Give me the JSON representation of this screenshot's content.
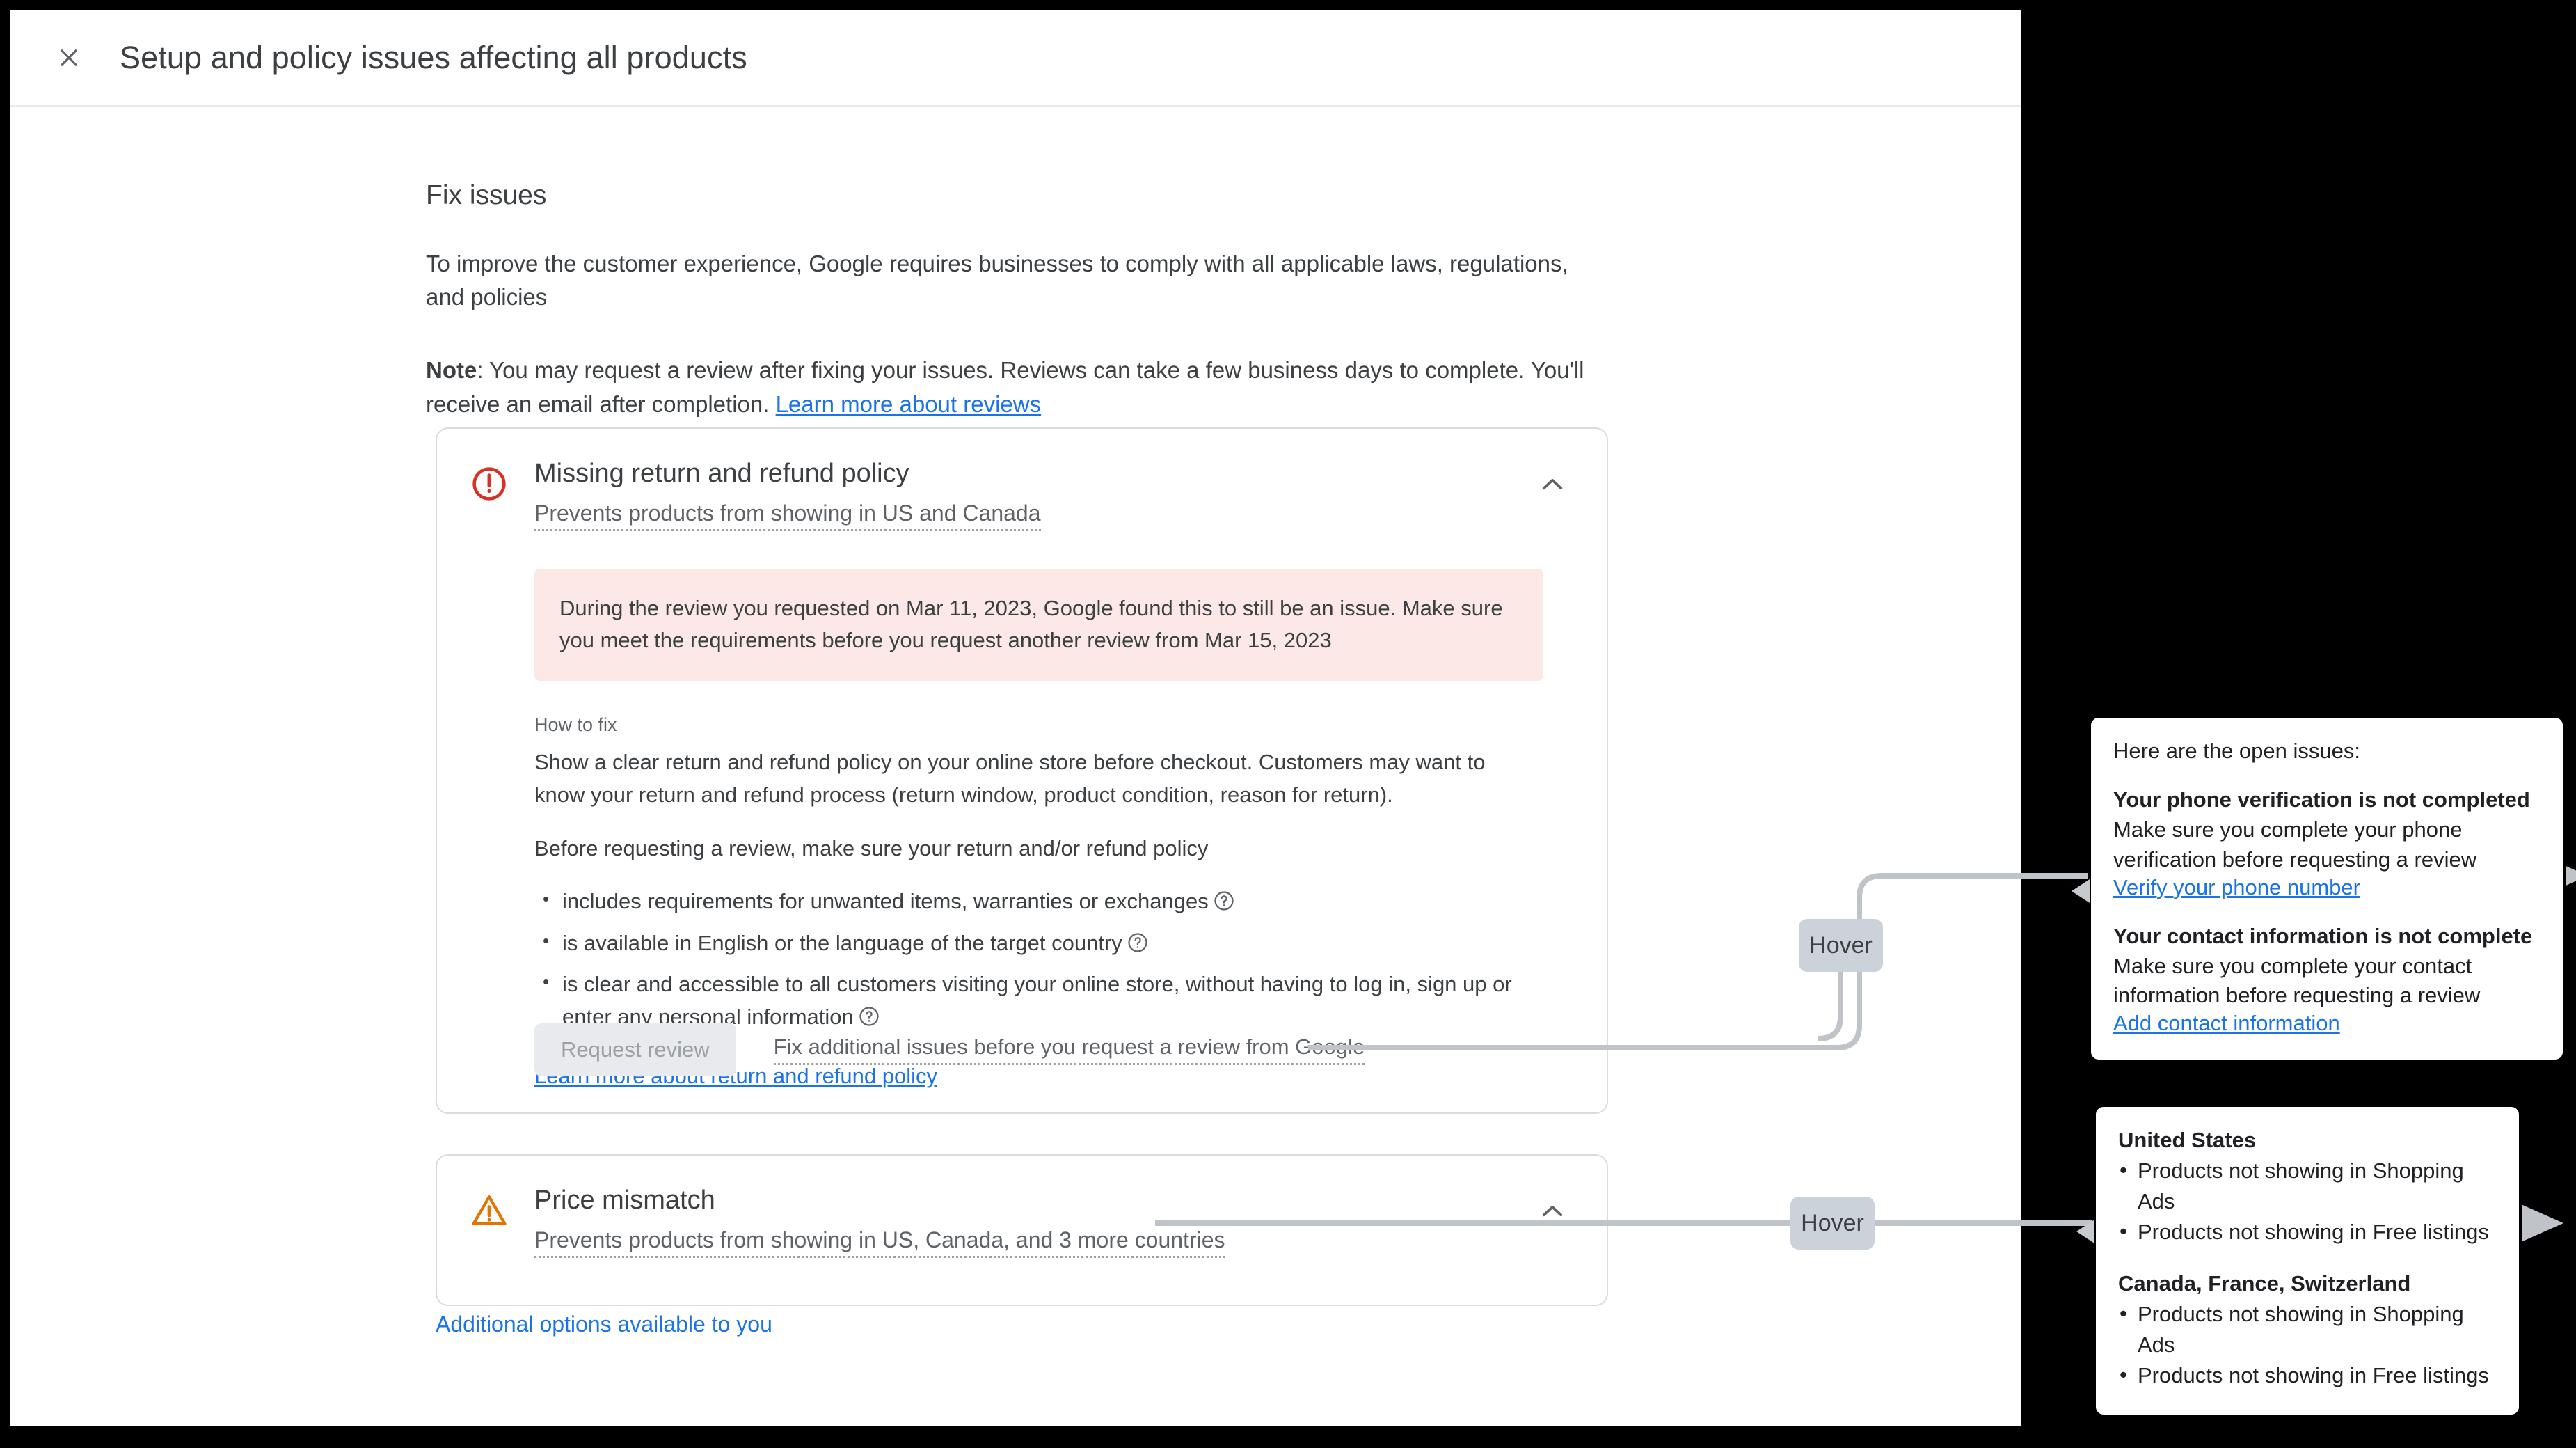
{
  "window": {
    "title": "Setup and policy issues affecting all products",
    "close_icon": "close-icon"
  },
  "main": {
    "section_title": "Fix issues",
    "intro": "To improve the customer experience, Google requires businesses to comply with all applicable laws, regulations, and policies",
    "note_label": "Note",
    "note_body": ": You may request a review after fixing your issues. Reviews can take a few business days to complete. You'll receive an email after completion. ",
    "note_link": "Learn more about reviews",
    "additional_options_link": "Additional options available to you"
  },
  "cards": [
    {
      "id": "return-policy",
      "status_icon": "error-circle-icon",
      "status_color": "#d93025",
      "title": "Missing return and refund policy",
      "subtitle": "Prevents products from showing in US and Canada",
      "collapse_icon": "chevron-up-icon",
      "banner": "During the review you requested on Mar 11, 2023, Google found this to still be an issue. Make sure you meet the requirements before you request another review from Mar 15, 2023",
      "banner_color": "#fce8e6",
      "howto_label": "How to fix",
      "howto_paragraph": "Show a clear return and refund policy on your online store before checkout. Customers may want to know your return and refund process (return window, product condition, reason for return).",
      "requirements_intro": "Before requesting a review, make sure your return and/or refund policy",
      "requirements": [
        "includes requirements for unwanted items, warranties or exchanges",
        "is available in English or the language of the target country",
        "is clear and accessible to all customers visiting your online store, without having to log in, sign up or enter any personal information"
      ],
      "policy_link": "Learn more about return and refund policy",
      "request_review_label": "Request review",
      "fix_additional_note": "Fix additional issues before you request a review from Google"
    },
    {
      "id": "price-mismatch",
      "status_icon": "warning-triangle-icon",
      "status_color": "#e37400",
      "title": "Price mismatch",
      "subtitle": "Prevents products from showing in US, Canada, and 3 more countries",
      "collapse_icon": "chevron-up-icon"
    }
  ],
  "annotations": {
    "hover_label_1": "Hover",
    "hover_label_2": "Hover"
  },
  "callouts": {
    "open_issues": {
      "intro": "Here are the open issues:",
      "items": [
        {
          "heading": "Your phone verification is not completed",
          "body": "Make sure you complete your phone verification before requesting a review",
          "link": "Verify your phone number"
        },
        {
          "heading": "Your contact information is not complete",
          "body": "Make sure you complete your contact information before requesting a review",
          "link": "Add contact information"
        }
      ]
    },
    "countries": {
      "groups": [
        {
          "heading": "United States",
          "items": [
            "Products not showing in Shopping Ads",
            "Products not showing in Free listings"
          ]
        },
        {
          "heading": "Canada, France, Switzerland",
          "items": [
            "Products not showing in Shopping Ads",
            "Products not showing in Free listings"
          ]
        }
      ]
    }
  },
  "colors": {
    "link": "#1a73e8",
    "error": "#d93025",
    "warning": "#e37400",
    "text": "#3c4043",
    "muted": "#5f6368",
    "chip": "#ccd2d9",
    "connector": "#c0c4c8"
  }
}
